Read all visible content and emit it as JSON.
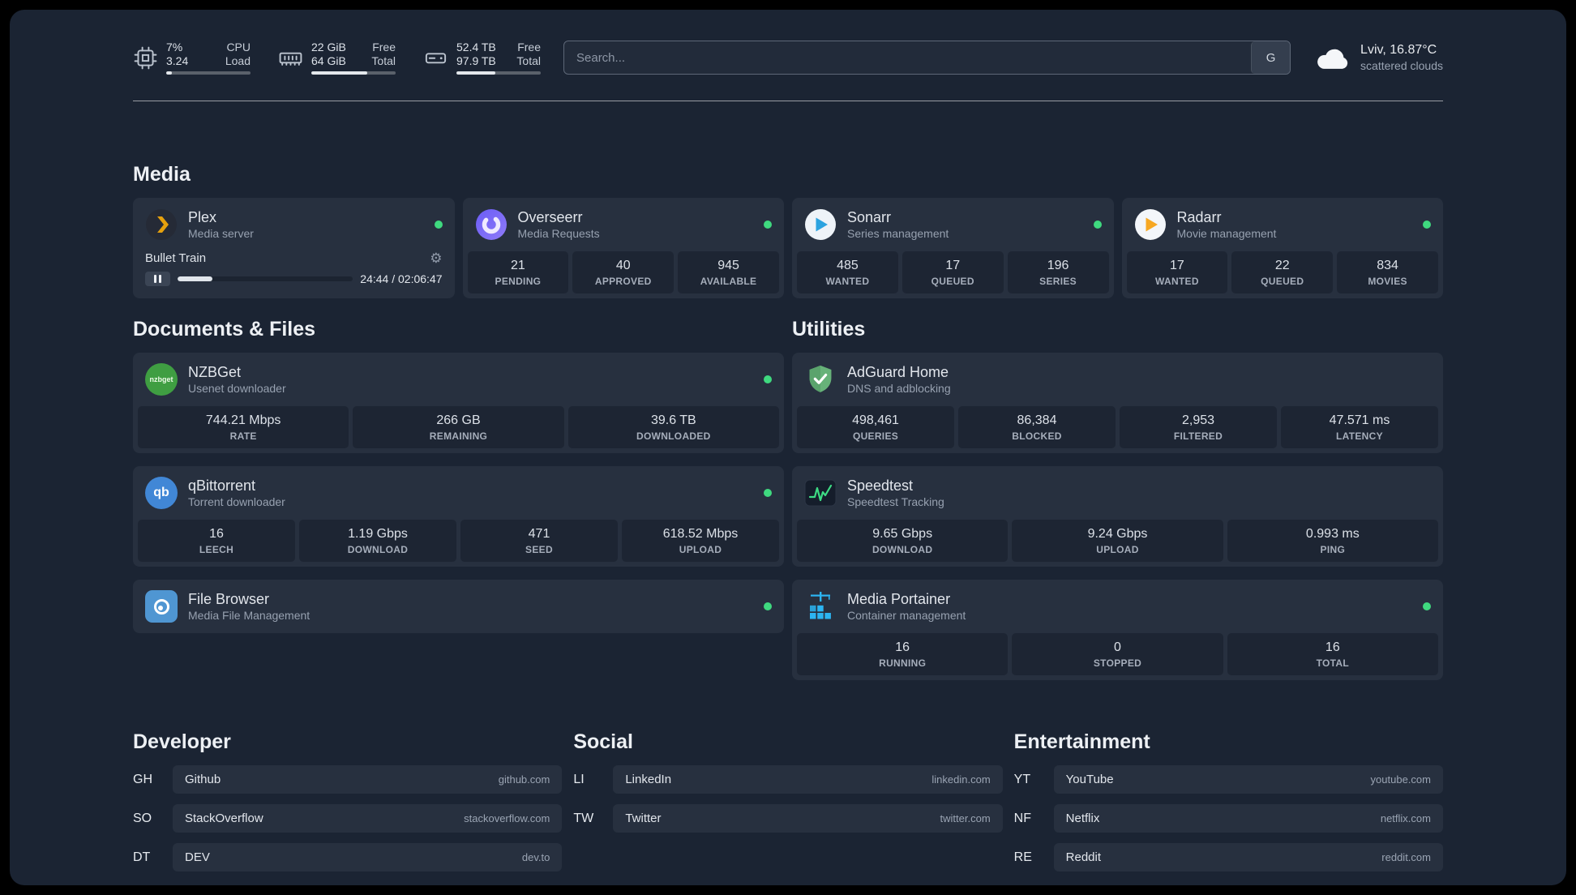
{
  "topbar": {
    "cpu": {
      "line1": "7%",
      "line2": "3.24",
      "label1": "CPU",
      "label2": "Load",
      "progress": 7
    },
    "memory": {
      "line1": "22 GiB",
      "line2": "64 GiB",
      "label1": "Free",
      "label2": "Total",
      "progress": 66
    },
    "disk": {
      "line1": "52.4 TB",
      "line2": "97.9 TB",
      "label1": "Free",
      "label2": "Total",
      "progress": 46
    },
    "search": {
      "placeholder": "Search...",
      "button": "G"
    },
    "weather": {
      "location": "Lviv, 16.87°C",
      "condition": "scattered clouds"
    }
  },
  "media": {
    "title": "Media",
    "plex": {
      "name": "Plex",
      "desc": "Media server",
      "now_playing": "Bullet Train",
      "time": "24:44 / 02:06:47",
      "progress": 20
    },
    "overseerr": {
      "name": "Overseerr",
      "desc": "Media Requests",
      "stats": [
        {
          "value": "21",
          "label": "PENDING"
        },
        {
          "value": "40",
          "label": "APPROVED"
        },
        {
          "value": "945",
          "label": "AVAILABLE"
        }
      ]
    },
    "sonarr": {
      "name": "Sonarr",
      "desc": "Series management",
      "stats": [
        {
          "value": "485",
          "label": "WANTED"
        },
        {
          "value": "17",
          "label": "QUEUED"
        },
        {
          "value": "196",
          "label": "SERIES"
        }
      ]
    },
    "radarr": {
      "name": "Radarr",
      "desc": "Movie management",
      "stats": [
        {
          "value": "17",
          "label": "WANTED"
        },
        {
          "value": "22",
          "label": "QUEUED"
        },
        {
          "value": "834",
          "label": "MOVIES"
        }
      ]
    }
  },
  "documents": {
    "title": "Documents & Files",
    "nzbget": {
      "name": "NZBGet",
      "desc": "Usenet downloader",
      "icon_text": "nzbget",
      "stats": [
        {
          "value": "744.21 Mbps",
          "label": "RATE"
        },
        {
          "value": "266 GB",
          "label": "REMAINING"
        },
        {
          "value": "39.6 TB",
          "label": "DOWNLOADED"
        }
      ]
    },
    "qbittorrent": {
      "name": "qBittorrent",
      "desc": "Torrent downloader",
      "icon_text": "qb",
      "stats": [
        {
          "value": "16",
          "label": "LEECH"
        },
        {
          "value": "1.19 Gbps",
          "label": "DOWNLOAD"
        },
        {
          "value": "471",
          "label": "SEED"
        },
        {
          "value": "618.52 Mbps",
          "label": "UPLOAD"
        }
      ]
    },
    "filebrowser": {
      "name": "File Browser",
      "desc": "Media File Management"
    }
  },
  "utilities": {
    "title": "Utilities",
    "adguard": {
      "name": "AdGuard Home",
      "desc": "DNS and adblocking",
      "stats": [
        {
          "value": "498,461",
          "label": "QUERIES"
        },
        {
          "value": "86,384",
          "label": "BLOCKED"
        },
        {
          "value": "2,953",
          "label": "FILTERED"
        },
        {
          "value": "47.571 ms",
          "label": "LATENCY"
        }
      ]
    },
    "speedtest": {
      "name": "Speedtest",
      "desc": "Speedtest Tracking",
      "stats": [
        {
          "value": "9.65 Gbps",
          "label": "DOWNLOAD"
        },
        {
          "value": "9.24 Gbps",
          "label": "UPLOAD"
        },
        {
          "value": "0.993 ms",
          "label": "PING"
        }
      ]
    },
    "portainer": {
      "name": "Media Portainer",
      "desc": "Container management",
      "stats": [
        {
          "value": "16",
          "label": "RUNNING"
        },
        {
          "value": "0",
          "label": "STOPPED"
        },
        {
          "value": "16",
          "label": "TOTAL"
        }
      ]
    }
  },
  "bookmarks": [
    {
      "title": "Developer",
      "items": [
        {
          "abbr": "GH",
          "name": "Github",
          "domain": "github.com"
        },
        {
          "abbr": "SO",
          "name": "StackOverflow",
          "domain": "stackoverflow.com"
        },
        {
          "abbr": "DT",
          "name": "DEV",
          "domain": "dev.to"
        }
      ]
    },
    {
      "title": "Social",
      "items": [
        {
          "abbr": "LI",
          "name": "LinkedIn",
          "domain": "linkedin.com"
        },
        {
          "abbr": "TW",
          "name": "Twitter",
          "domain": "twitter.com"
        }
      ]
    },
    {
      "title": "Entertainment",
      "items": [
        {
          "abbr": "YT",
          "name": "YouTube",
          "domain": "youtube.com"
        },
        {
          "abbr": "NF",
          "name": "Netflix",
          "domain": "netflix.com"
        },
        {
          "abbr": "RE",
          "name": "Reddit",
          "domain": "reddit.com"
        }
      ]
    }
  ]
}
